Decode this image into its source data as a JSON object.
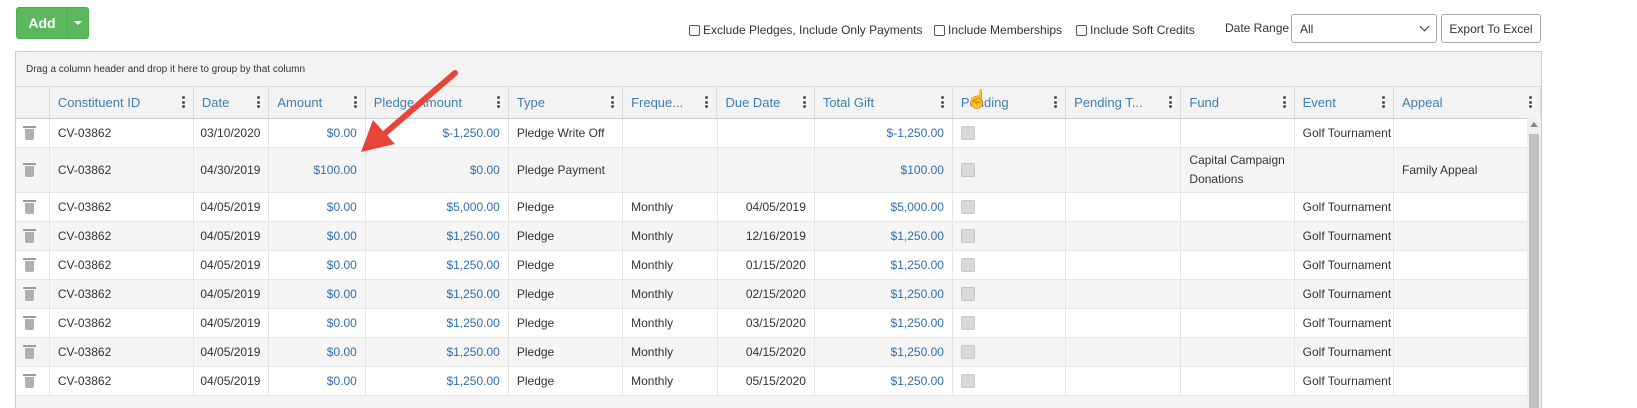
{
  "toolbar": {
    "add_label": "Add",
    "exclude_pledges_label": "Exclude Pledges, Include Only Payments",
    "include_memberships_label": "Include Memberships",
    "include_soft_credits_label": "Include Soft Credits",
    "date_range_label": "Date Range",
    "date_range_value": "All",
    "export_label": "Export To Excel"
  },
  "grid": {
    "group_hint": "Drag a column header and drop it here to group by that column",
    "columns": [
      "Constituent ID",
      "Date",
      "Amount",
      "Pledge Amount",
      "Type",
      "Freque...",
      "Due Date",
      "Total Gift",
      "Pending",
      "Pending T...",
      "Fund",
      "Event",
      "Appeal"
    ],
    "rows": [
      {
        "id": "CV-03862",
        "date": "03/10/2020",
        "amount": "$0.00",
        "pledge": "$-1,250.00",
        "type": "Pledge Write Off",
        "freq": "",
        "due": "",
        "total": "$-1,250.00",
        "fund": "",
        "event": "Golf Tournament",
        "appeal": ""
      },
      {
        "id": "CV-03862",
        "date": "04/30/2019",
        "amount": "$100.00",
        "pledge": "$0.00",
        "type": "Pledge Payment",
        "freq": "",
        "due": "",
        "total": "$100.00",
        "fund": "Capital Campaign Donations",
        "event": "",
        "appeal": "Family Appeal"
      },
      {
        "id": "CV-03862",
        "date": "04/05/2019",
        "amount": "$0.00",
        "pledge": "$5,000.00",
        "type": "Pledge",
        "freq": "Monthly",
        "due": "04/05/2019",
        "total": "$5,000.00",
        "fund": "",
        "event": "Golf Tournament",
        "appeal": ""
      },
      {
        "id": "CV-03862",
        "date": "04/05/2019",
        "amount": "$0.00",
        "pledge": "$1,250.00",
        "type": "Pledge",
        "freq": "Monthly",
        "due": "12/16/2019",
        "total": "$1,250.00",
        "fund": "",
        "event": "Golf Tournament",
        "appeal": ""
      },
      {
        "id": "CV-03862",
        "date": "04/05/2019",
        "amount": "$0.00",
        "pledge": "$1,250.00",
        "type": "Pledge",
        "freq": "Monthly",
        "due": "01/15/2020",
        "total": "$1,250.00",
        "fund": "",
        "event": "Golf Tournament",
        "appeal": ""
      },
      {
        "id": "CV-03862",
        "date": "04/05/2019",
        "amount": "$0.00",
        "pledge": "$1,250.00",
        "type": "Pledge",
        "freq": "Monthly",
        "due": "02/15/2020",
        "total": "$1,250.00",
        "fund": "",
        "event": "Golf Tournament",
        "appeal": ""
      },
      {
        "id": "CV-03862",
        "date": "04/05/2019",
        "amount": "$0.00",
        "pledge": "$1,250.00",
        "type": "Pledge",
        "freq": "Monthly",
        "due": "03/15/2020",
        "total": "$1,250.00",
        "fund": "",
        "event": "Golf Tournament",
        "appeal": ""
      },
      {
        "id": "CV-03862",
        "date": "04/05/2019",
        "amount": "$0.00",
        "pledge": "$1,250.00",
        "type": "Pledge",
        "freq": "Monthly",
        "due": "04/15/2020",
        "total": "$1,250.00",
        "fund": "",
        "event": "Golf Tournament",
        "appeal": ""
      },
      {
        "id": "CV-03862",
        "date": "04/05/2019",
        "amount": "$0.00",
        "pledge": "$1,250.00",
        "type": "Pledge",
        "freq": "Monthly",
        "due": "05/15/2020",
        "total": "$1,250.00",
        "fund": "",
        "event": "Golf Tournament",
        "appeal": ""
      }
    ]
  },
  "colors": {
    "accent_green": "#5cb85c",
    "header_text": "#3e7fb0",
    "money_text": "#2f6fb0",
    "annotation_arrow": "#e8443a"
  }
}
